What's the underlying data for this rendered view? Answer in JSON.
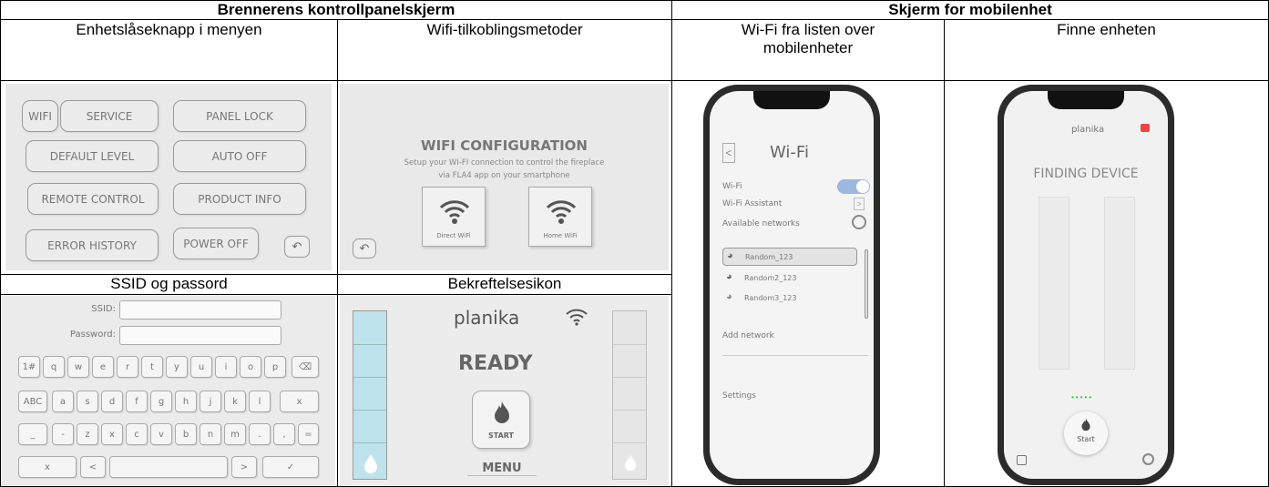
{
  "table": {
    "header_left": "Brennerens kontrollpanelskjerm",
    "header_right": "Skjerm for mobilenhet",
    "col1": "Enhetslåseknapp i menyen",
    "col2": "Wifi-tilkoblingsmetoder",
    "col3": "Wi-Fi fra listen over mobilenheter",
    "col4": "Finne enheten",
    "row2_col1": "SSID og passord",
    "row2_col2": "Bekreftelsesikon"
  },
  "menu_panel": {
    "wifi": "WIFI",
    "service": "SERVICE",
    "panel_lock": "PANEL LOCK",
    "default_level": "DEFAULT LEVEL",
    "auto_off": "AUTO OFF",
    "remote_control": "REMOTE CONTROL",
    "product_info": "PRODUCT INFO",
    "error_history": "ERROR HISTORY",
    "power_off": "POWER OFF",
    "back_icon": "return-arrow-icon"
  },
  "wifi_config": {
    "title": "WIFI CONFIGURATION",
    "subtitle_1": "Setup your WI-FI connection to control the fireplace",
    "subtitle_2": "via FLA4 app on your smartphone",
    "direct": "Direct WiFi",
    "home": "Home WiFi"
  },
  "ssid_form": {
    "ssid_label": "SSID:",
    "password_label": "Password:",
    "row1": [
      "1#",
      "q",
      "w",
      "e",
      "r",
      "t",
      "y",
      "u",
      "i",
      "o",
      "p",
      "⌫"
    ],
    "row2": [
      "ABC",
      "a",
      "s",
      "d",
      "f",
      "g",
      "h",
      "j",
      "k",
      "l",
      "x"
    ],
    "row3": [
      "_",
      "-",
      "z",
      "x",
      "c",
      "v",
      "b",
      "n",
      "m",
      ".",
      ",",
      "="
    ],
    "row4": [
      "x",
      "<",
      "",
      ">",
      "✓"
    ]
  },
  "ready_panel": {
    "brand": "planika",
    "status": "READY",
    "start": "START",
    "menu": "MENU"
  },
  "phone_wifi": {
    "title": "Wi-Fi",
    "wifi_label": "Wi-Fi",
    "assistant": "Wi-Fi Assistant",
    "available": "Available networks",
    "networks": [
      "Random_123",
      "Random2_123",
      "Random3_123"
    ],
    "add_network": "Add network",
    "settings": "Settings"
  },
  "phone_finding": {
    "brand": "planika",
    "title": "FINDING DEVICE",
    "start": "Start"
  }
}
